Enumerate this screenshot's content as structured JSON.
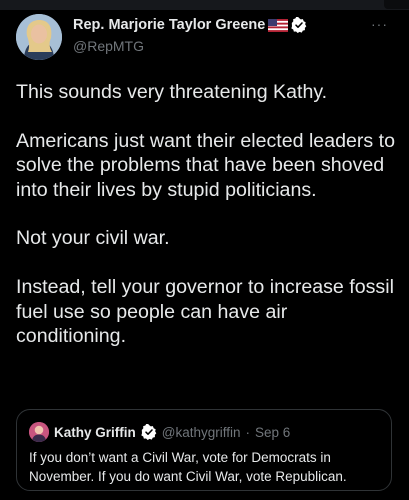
{
  "tweet": {
    "author_name": "Rep. Marjorie Taylor Greene",
    "author_handle": "@RepMTG",
    "more_label": "···",
    "paragraphs": [
      "This sounds very threatening Kathy.",
      "Americans just want their elected leaders to solve the problems that have been shoved into their lives by stupid politicians.",
      "Not your civil war.",
      "Instead, tell your governor to increase fossil fuel use so people can have air conditioning."
    ]
  },
  "quote": {
    "author_name": "Kathy Griffin",
    "author_handle": "@kathygriffin",
    "separator": "·",
    "date": "Sep 6",
    "text": "If you don’t want a Civil War, vote for Democrats in November. If you do want Civil War, vote Republican."
  },
  "colors": {
    "background": "#000000",
    "text_primary": "#e7e9ea",
    "text_secondary": "#71767b",
    "verified_badge": "#ffffff",
    "border": "#2f3336"
  },
  "icons": [
    "flag-us-icon",
    "verified-badge-icon",
    "more-options-icon"
  ]
}
